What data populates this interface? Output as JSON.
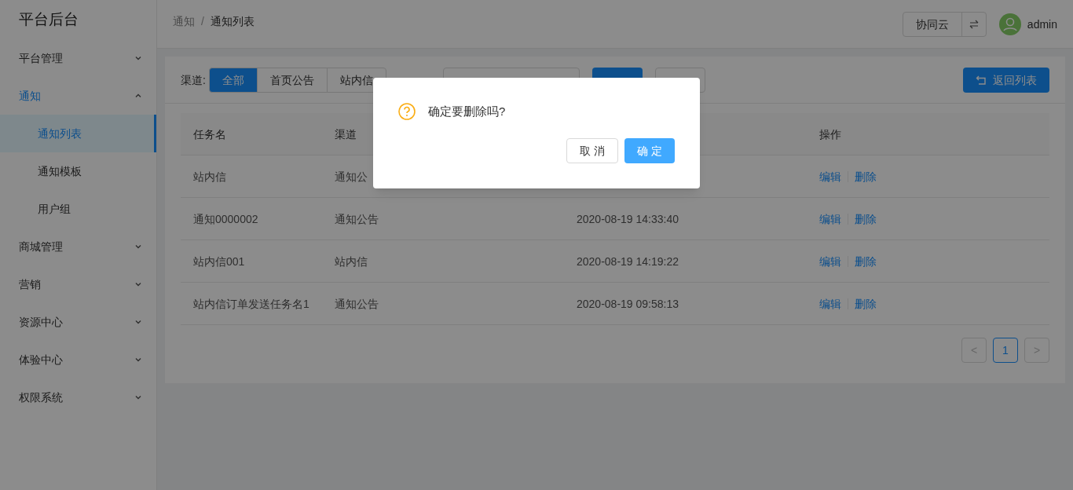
{
  "sidebar": {
    "title": "平台后台",
    "items": [
      {
        "label": "平台管理",
        "expanded": false
      },
      {
        "label": "通知",
        "expanded": true,
        "children": [
          {
            "label": "通知列表",
            "selected": true
          },
          {
            "label": "通知模板",
            "selected": false
          },
          {
            "label": "用户组",
            "selected": false
          }
        ]
      },
      {
        "label": "商城管理",
        "expanded": false
      },
      {
        "label": "营销",
        "expanded": false
      },
      {
        "label": "资源中心",
        "expanded": false
      },
      {
        "label": "体验中心",
        "expanded": false
      },
      {
        "label": "权限系统",
        "expanded": false
      }
    ]
  },
  "header": {
    "breadcrumb": [
      "通知",
      "通知列表"
    ],
    "breadcrumb_separator": "/",
    "org_button": "协同云",
    "user": "admin"
  },
  "filters": {
    "channel_label": "渠道:",
    "channels": [
      {
        "label": "全部",
        "selected": true
      },
      {
        "label": "首页公告",
        "selected": false
      },
      {
        "label": "站内信",
        "selected": false
      }
    ],
    "back_button": "返回列表"
  },
  "table": {
    "columns": [
      "任务名",
      "渠道",
      "操作"
    ],
    "rows": [
      {
        "name": "站内信",
        "channel": "通知公",
        "actions": [
          "编辑",
          "删除"
        ]
      },
      {
        "name": "通知0000002",
        "channel": "通知公告",
        "time": "2020-08-19 14:33:40",
        "actions": [
          "编辑",
          "删除"
        ]
      },
      {
        "name": "站内信001",
        "channel": "站内信",
        "time": "2020-08-19 14:19:22",
        "actions": [
          "编辑",
          "删除"
        ]
      },
      {
        "name": "站内信订单发送任务名1",
        "channel": "通知公告",
        "time": "2020-08-19 09:58:13",
        "actions": [
          "编辑",
          "删除"
        ]
      }
    ]
  },
  "pagination": {
    "prev": "<",
    "pages": [
      {
        "label": "1",
        "selected": true
      }
    ],
    "next": ">"
  },
  "dialog": {
    "message": "确定要删除吗?",
    "buttons": [
      "取 消",
      "确 定"
    ]
  }
}
